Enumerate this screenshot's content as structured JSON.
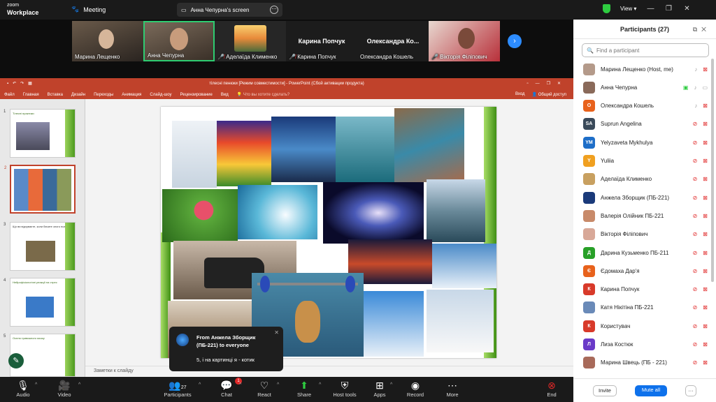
{
  "topbar": {
    "logo_line1": "zoom",
    "logo_line2": "Workplace",
    "meeting": "Meeting",
    "screen_label": "Анна Чепурна's screen",
    "view": "View"
  },
  "gallery": [
    {
      "name": "Марина Лещенко",
      "mic_off": false,
      "video": true
    },
    {
      "name": "Анна Чепурна",
      "mic_off": false,
      "video": true,
      "active": true
    },
    {
      "name": "Аделаїда Клименко",
      "mic_off": true,
      "video": true
    },
    {
      "name": "Карина Попчук",
      "mic_off": true,
      "video": false,
      "big": "Карина Попчук"
    },
    {
      "name": "Олександра Кошель",
      "mic_off": false,
      "video": false,
      "big": "Олександра Ко..."
    },
    {
      "name": "Вікторія Філіпович",
      "mic_off": true,
      "video": true
    }
  ],
  "ppt": {
    "title": "тілесні пенюки [Режим совместимости] - PowerPoint (Сбой активации продукта)",
    "menu": [
      "Файл",
      "Главная",
      "Вставка",
      "Дизайн",
      "Переходы",
      "Анимация",
      "Слайд-шоу",
      "Рецензирование",
      "Вид"
    ],
    "search": "Что вы хотите сделать?",
    "login": "Вход",
    "share": "Общий доступ",
    "notes": "Заметки к слайду",
    "thumbs": [
      {
        "num": "1",
        "text": "Тілесні практики"
      },
      {
        "num": "2",
        "text": ""
      },
      {
        "num": "3",
        "text": "Що ви відчуваєте, коли бачите злого пса?"
      },
      {
        "num": "4",
        "text": "Нейрофізіологічні реакції на стрес"
      },
      {
        "num": "5",
        "text": "Оселя тривожного мозку"
      }
    ]
  },
  "toast": {
    "from": "From Анжела Зборщик (ПБ-221) to everyone",
    "message": "5, і на картинці  я - котик"
  },
  "toolbar": {
    "audio": "Audio",
    "video": "Video",
    "participants": "Participants",
    "participants_count": "27",
    "chat": "Chat",
    "chat_badge": "1",
    "react": "React",
    "share": "Share",
    "host_tools": "Host tools",
    "apps": "Apps",
    "record": "Record",
    "more": "More",
    "end": "End"
  },
  "panel": {
    "title": "Participants (27)",
    "search_placeholder": "Find a participant",
    "invite": "Invite",
    "mute_all": "Mute all",
    "more": "···",
    "participants": [
      {
        "name": "Марина Лещенко (Host, me)",
        "initial": "",
        "color": "#b49a8a",
        "mic": "on",
        "video": "off"
      },
      {
        "name": "Анна Чепурна",
        "initial": "",
        "color": "#8a6a5a",
        "mic": "on",
        "video": "on",
        "screen": true
      },
      {
        "name": "Олександра Кошель",
        "initial": "О",
        "color": "#e8621c",
        "mic": "on",
        "video": "off"
      },
      {
        "name": "Suprun Angelina",
        "initial": "SA",
        "color": "#3a4a5a",
        "mic": "off",
        "video": "off"
      },
      {
        "name": "Yelyzaveta Mykhulya",
        "initial": "YM",
        "color": "#1e6ec8",
        "mic": "off",
        "video": "off"
      },
      {
        "name": "Yuliia",
        "initial": "Y",
        "color": "#f0a020",
        "mic": "off",
        "video": "off"
      },
      {
        "name": "Аделаїда Клименко",
        "initial": "",
        "color": "#c8a060",
        "mic": "off",
        "video": "off"
      },
      {
        "name": "Анжела Зборщик (ПБ-221)",
        "initial": "",
        "color": "#1a3a7a",
        "mic": "off",
        "video": "off"
      },
      {
        "name": "Валерія Олійник ПБ-221",
        "initial": "",
        "color": "#c88a6a",
        "mic": "off",
        "video": "off"
      },
      {
        "name": "Вікторія Філіпович",
        "initial": "",
        "color": "#d8a898",
        "mic": "off",
        "video": "off"
      },
      {
        "name": "Дарина Кузьменко ПБ-211",
        "initial": "Д",
        "color": "#28a028",
        "mic": "off",
        "video": "off"
      },
      {
        "name": "Єдомаха Дар'я",
        "initial": "Є",
        "color": "#e8621c",
        "mic": "off",
        "video": "off"
      },
      {
        "name": "Карина Попчук",
        "initial": "К",
        "color": "#d83a2a",
        "mic": "off",
        "video": "off"
      },
      {
        "name": "Катя Нікітіна ПБ-221",
        "initial": "",
        "color": "#6a8ab8",
        "mic": "off",
        "video": "off"
      },
      {
        "name": "Користувач",
        "initial": "К",
        "color": "#d83a2a",
        "mic": "off",
        "video": "off"
      },
      {
        "name": "Лиза Костюк",
        "initial": "Л",
        "color": "#6a3ac8",
        "mic": "off",
        "video": "off"
      },
      {
        "name": "Марина Швець (ПБ - 221)",
        "initial": "",
        "color": "#a86a5a",
        "mic": "off",
        "video": "off"
      }
    ]
  }
}
